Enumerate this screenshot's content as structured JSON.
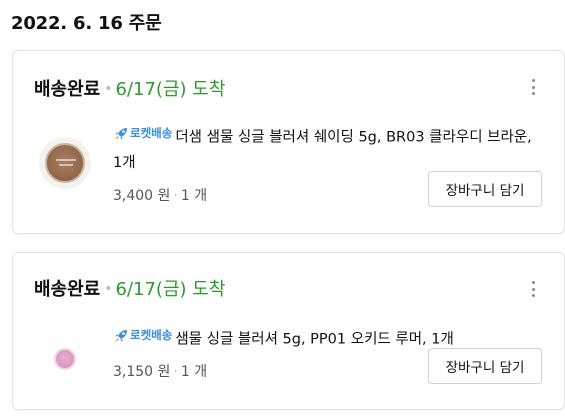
{
  "order": {
    "date_label": "2022. 6. 16 주문",
    "items": [
      {
        "status": "배송완료",
        "arrival": "6/17(금) 도착",
        "rocket_label": "로켓배송",
        "title": "더샘 샘물 싱글 블러셔 쉐이딩 5g, BR03 클라우디 브라운, 1개",
        "price": "3,400 원",
        "qty": "1 개",
        "cart_button": "장바구니 담기",
        "thumb_icon": "blush-compact-brown"
      },
      {
        "status": "배송완료",
        "arrival": "6/17(금) 도착",
        "rocket_label": "로켓배송",
        "title": "샘물 싱글 블러셔 5g, PP01 오키드 루머, 1개",
        "price": "3,150 원",
        "qty": "1 개",
        "cart_button": "장바구니 담기",
        "thumb_icon": "blush-compact-pink"
      }
    ]
  },
  "colors": {
    "arrival_green": "#2e9a2e",
    "rocket_blue": "#3a8fd6"
  }
}
